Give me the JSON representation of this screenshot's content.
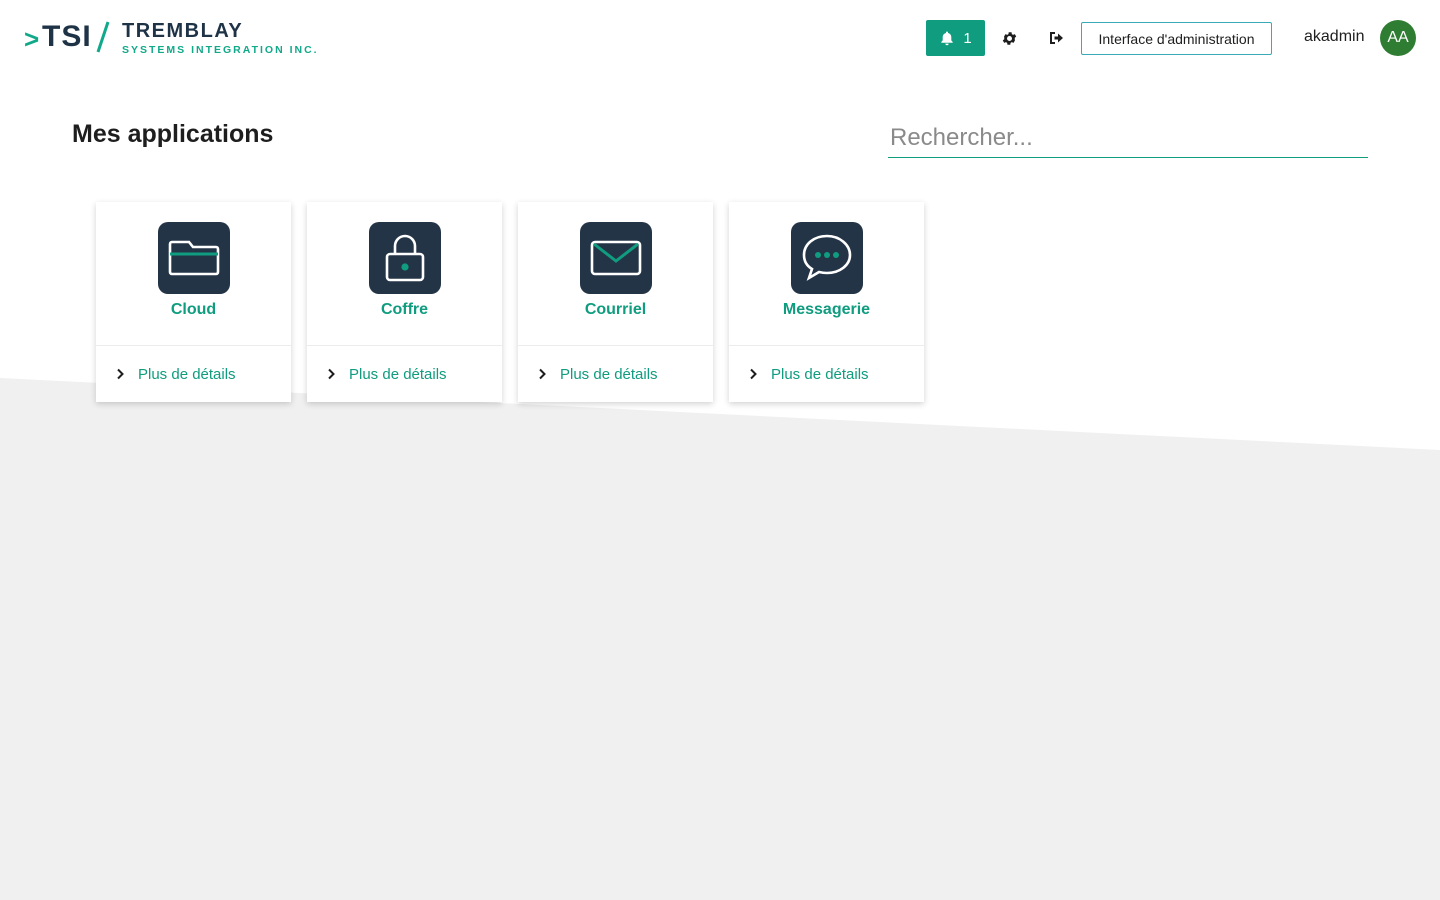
{
  "colors": {
    "accent": "#0f9c7f",
    "navy": "#243447",
    "avatar": "#2f7d32",
    "background_grey": "#f0f0f0"
  },
  "brand": {
    "mark": ">",
    "short": "TSI",
    "name": "TREMBLAY",
    "tagline": "SYSTEMS INTEGRATION INC."
  },
  "header": {
    "notification_count": "1",
    "admin_button_label": "Interface d'administration",
    "username": "akadmin",
    "avatar_initials": "AA",
    "icons": [
      "bell-icon",
      "gear-icon",
      "sign-out-icon"
    ]
  },
  "main": {
    "title": "Mes applications",
    "search_placeholder": "Rechercher...",
    "apps": [
      {
        "name": "Cloud",
        "icon": "folder-icon",
        "details_label": "Plus de détails"
      },
      {
        "name": "Coffre",
        "icon": "lock-icon",
        "details_label": "Plus de détails"
      },
      {
        "name": "Courriel",
        "icon": "envelope-icon",
        "details_label": "Plus de détails"
      },
      {
        "name": "Messagerie",
        "icon": "chat-bubble-icon",
        "details_label": "Plus de détails"
      }
    ]
  }
}
